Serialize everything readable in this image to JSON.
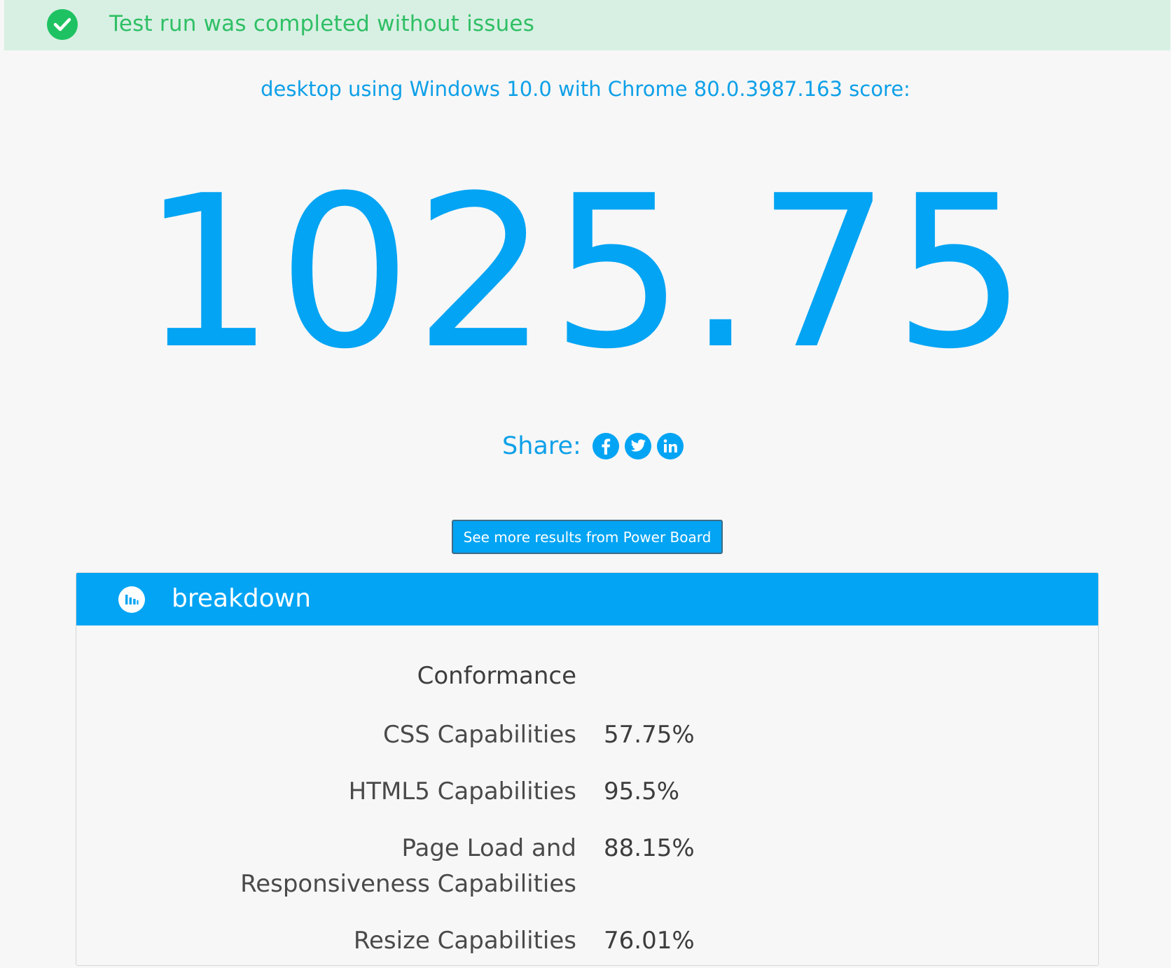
{
  "banner": {
    "message": "Test run was completed without issues",
    "icon": "check-circle-icon",
    "color": "#1fc262"
  },
  "subtitle": "desktop using Windows 10.0 with Chrome 80.0.3987.163 score:",
  "score": "1025.75",
  "share": {
    "label": "Share:",
    "networks": [
      "facebook-icon",
      "twitter-icon",
      "linkedin-icon"
    ]
  },
  "power_board_button": "See more results from Power Board",
  "breakdown": {
    "title": "breakdown",
    "icon": "bar-chart-icon",
    "section_title": "Conformance",
    "rows": [
      {
        "label": "CSS Capabilities",
        "value": "57.75%"
      },
      {
        "label": "HTML5 Capabilities",
        "value": "95.5%"
      },
      {
        "label": "Page Load and Responsiveness Capabilities",
        "value": "88.15%"
      },
      {
        "label": "Resize Capabilities",
        "value": "76.01%"
      }
    ]
  },
  "colors": {
    "accent": "#03a4f4",
    "banner_bg": "#d8f0e3",
    "banner_text": "#2fbf65"
  }
}
